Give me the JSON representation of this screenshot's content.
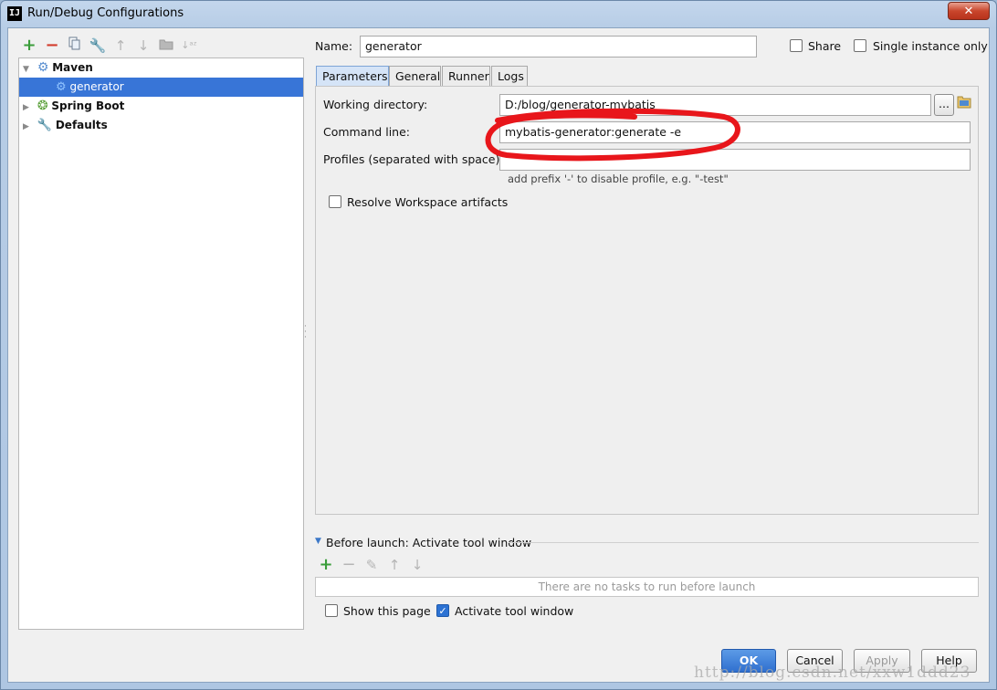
{
  "window": {
    "title": "Run/Debug Configurations",
    "close_glyph": "✕"
  },
  "toolbar": {
    "icons": [
      "add-icon",
      "remove-icon",
      "copy-icon",
      "wrench-icon",
      "move-up-icon",
      "move-down-icon",
      "folder-icon",
      "sort-icon"
    ]
  },
  "tree": {
    "items": [
      {
        "label": "Maven",
        "expanded": true,
        "icon": "maven-gear-icon"
      },
      {
        "label": "generator",
        "selected": true,
        "icon": "gear-icon"
      },
      {
        "label": "Spring Boot",
        "expanded": false,
        "icon": "spring-boot-icon"
      },
      {
        "label": "Defaults",
        "expanded": false,
        "icon": "wrench-icon"
      }
    ]
  },
  "header": {
    "name_label": "Name:",
    "name_value": "generator",
    "share_label": "Share",
    "share_checked": false,
    "single_instance_label": "Single instance only",
    "single_instance_checked": false
  },
  "tabs": [
    {
      "label": "Parameters",
      "active": true
    },
    {
      "label": "General",
      "active": false
    },
    {
      "label": "Runner",
      "active": false
    },
    {
      "label": "Logs",
      "active": false
    }
  ],
  "parameters": {
    "working_dir_label": "Working directory:",
    "working_dir_value": "D:/blog/generator-mybatis",
    "browse_label": "...",
    "command_line_label": "Command line:",
    "command_line_value": "mybatis-generator:generate -e",
    "profiles_label": "Profiles (separated with space):",
    "profiles_value": "",
    "profiles_hint": "add prefix '-' to disable profile, e.g. \"-test\"",
    "resolve_workspace_label": "Resolve Workspace artifacts",
    "resolve_workspace_checked": false
  },
  "before_launch": {
    "title": "Before launch: Activate tool window",
    "empty_text": "There are no tasks to run before launch",
    "show_page_label": "Show this page",
    "show_page_checked": false,
    "activate_tool_label": "Activate tool window",
    "activate_tool_checked": true
  },
  "buttons": {
    "ok": "OK",
    "cancel": "Cancel",
    "apply": "Apply",
    "help": "Help"
  },
  "watermark": "http://blog.csdn.net/xxw1ddd23",
  "colors": {
    "selection": "#3875d7",
    "accent_add": "#3a9d3a",
    "annotation_red": "#e8161b",
    "primary_button": "#2f6fcf"
  }
}
